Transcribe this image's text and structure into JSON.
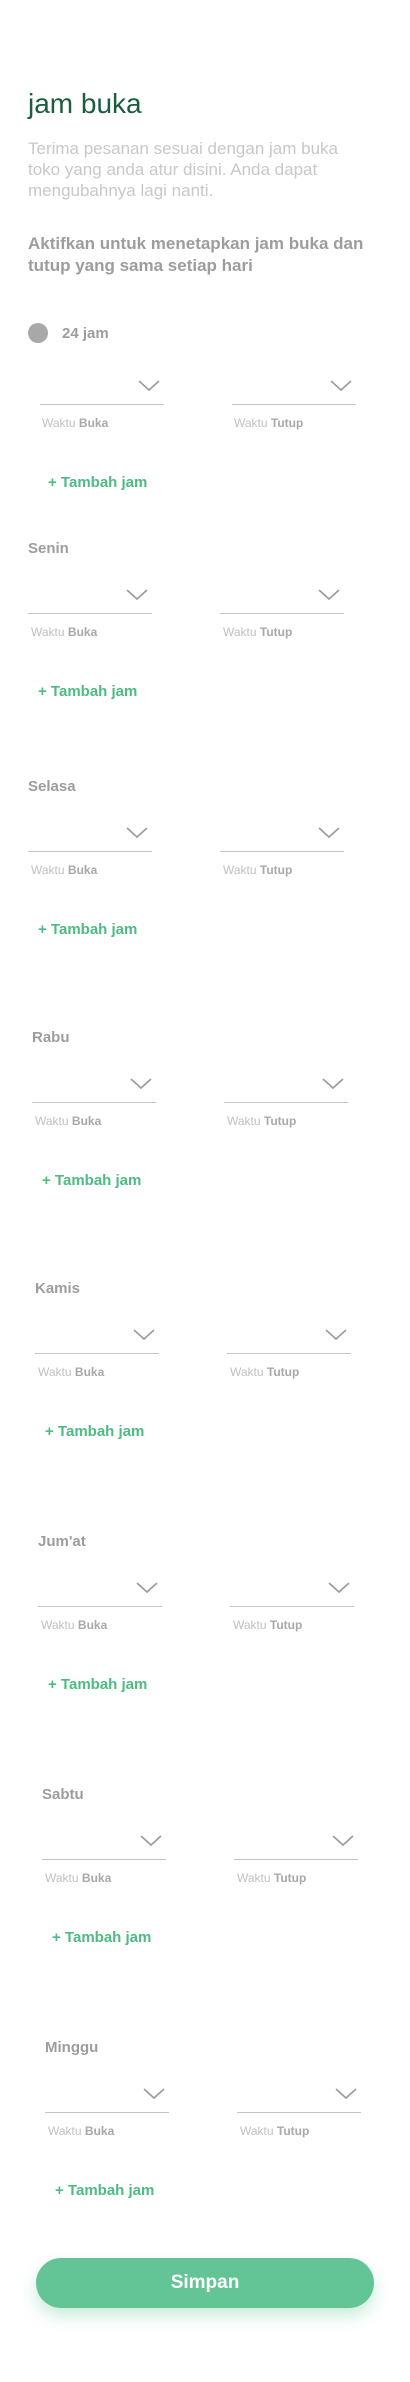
{
  "page": {
    "title": "jam buka",
    "description": "Terima pesanan sesuai dengan jam buka toko yang anda atur disini. Anda dapat mengubahnya lagi nanti.",
    "same_hours_hint": "Aktifkan untuk menetapkan jam buka dan tutup yang sama setiap hari"
  },
  "all_day": {
    "label": "24 jam",
    "open_caption_prefix": "Waktu ",
    "open_caption_bold": "Buka",
    "close_caption_prefix": "Waktu ",
    "close_caption_bold": "Tutup",
    "add_label": "+ Tambah jam"
  },
  "days": [
    {
      "name": "Senin",
      "open_prefix": "Waktu ",
      "open_bold": "Buka",
      "close_prefix": "Waktu ",
      "close_bold": "Tutup",
      "add_label": "+ Tambah jam"
    },
    {
      "name": "Selasa",
      "open_prefix": "Waktu ",
      "open_bold": "Buka",
      "close_prefix": "Waktu ",
      "close_bold": "Tutup",
      "add_label": "+ Tambah jam"
    },
    {
      "name": "Rabu",
      "open_prefix": "Waktu ",
      "open_bold": "Buka",
      "close_prefix": "Waktu ",
      "close_bold": "Tutup",
      "add_label": "+ Tambah jam"
    },
    {
      "name": "Kamis",
      "open_prefix": "Waktu ",
      "open_bold": "Buka",
      "close_prefix": "Waktu ",
      "close_bold": "Tutup",
      "add_label": "+ Tambah jam"
    },
    {
      "name": "Jum'at",
      "open_prefix": "Waktu ",
      "open_bold": "Buka",
      "close_prefix": "Waktu ",
      "close_bold": "Tutup",
      "add_label": "+ Tambah jam"
    },
    {
      "name": "Sabtu",
      "open_prefix": "Waktu ",
      "open_bold": "Buka",
      "close_prefix": "Waktu ",
      "close_bold": "Tutup",
      "add_label": "+ Tambah jam"
    },
    {
      "name": "Minggu",
      "open_prefix": "Waktu ",
      "open_bold": "Buka",
      "close_prefix": "Waktu ",
      "close_bold": "Tutup",
      "add_label": "+ Tambah jam"
    }
  ],
  "footer": {
    "save_label": "Simpan"
  },
  "colors": {
    "title": "#1d5c3f",
    "accent": "#4dbb82",
    "button": "#63c596"
  }
}
